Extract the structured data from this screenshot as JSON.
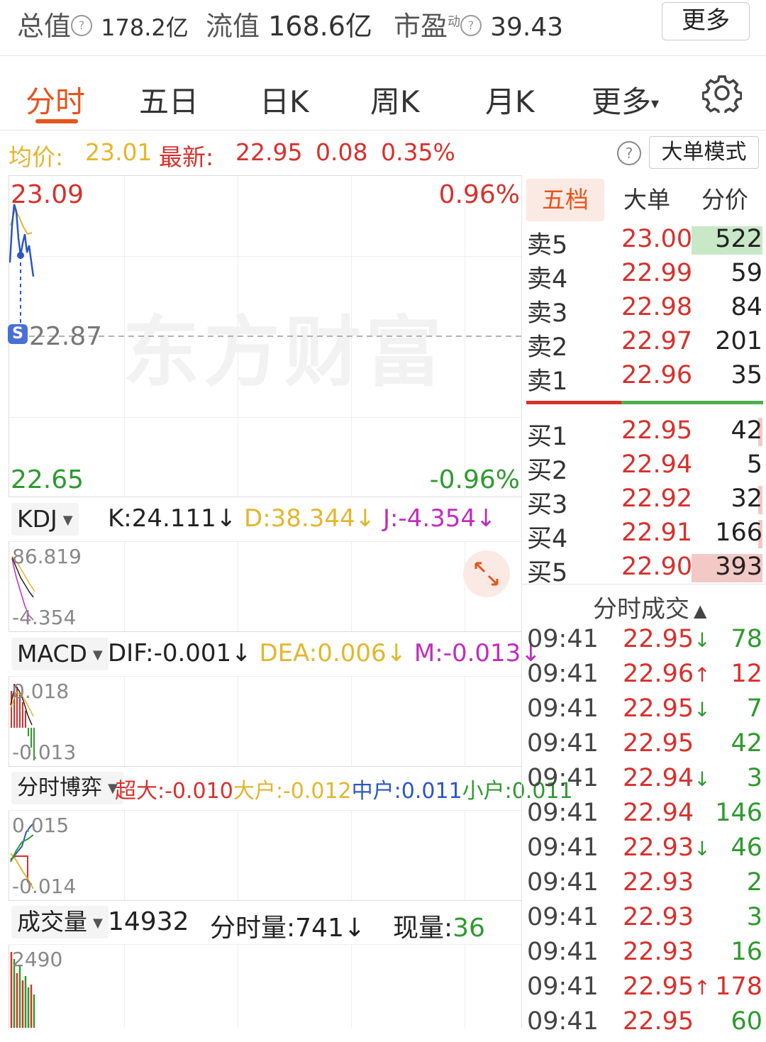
{
  "top": {
    "market_cap_label": "总值",
    "market_cap": "178.2亿",
    "float_label": "流值",
    "float_value": "168.6亿",
    "pe_label": "市盈",
    "pe_super": "动",
    "pe_value": "39.43",
    "more_label": "更多",
    "info_icon": "?"
  },
  "tabs": {
    "items": [
      "分时",
      "五日",
      "日K",
      "周K",
      "月K",
      "更多"
    ],
    "active": "分时",
    "more_caret": "▾"
  },
  "price_row": {
    "avg_label": "均价:",
    "avg": "23.01",
    "latest_label": "最新:",
    "latest": "22.95",
    "change": "0.08",
    "change_pct": "0.35%",
    "help": "?",
    "big_order_label": "大单模式"
  },
  "chart": {
    "high": "23.09",
    "high_pct": "0.96%",
    "mid": "22.87",
    "low": "22.65",
    "low_pct": "-0.96%",
    "watermark": "东方财富",
    "marker_letter": "S"
  },
  "kdj": {
    "name": "KDJ",
    "k": "K:24.111↓",
    "d": "D:38.344↓",
    "j": "J:-4.354↓",
    "max": "86.819",
    "min": "-4.354"
  },
  "macd": {
    "name": "MACD",
    "dif": "DIF:-0.001↓",
    "dea": "DEA:0.006↓",
    "m": "M:-0.013↓",
    "max": "0.018",
    "min": "-0.013"
  },
  "game": {
    "name": "分时博弈",
    "super": "超大:-0.010",
    "big": "大户:-0.012",
    "mid": "中户:0.011",
    "small": "小户:0.011",
    "max": "0.015",
    "min": "-0.014"
  },
  "volume": {
    "name": "成交量",
    "total": "14932",
    "minute_label": "分时量:",
    "minute": "741↓",
    "current_label": "现量:",
    "current": "36",
    "max": "2490"
  },
  "orderbook": {
    "tabs": [
      "五档",
      "大单",
      "分价"
    ],
    "asks": [
      {
        "label": "卖5",
        "price": "23.00",
        "vol": "522",
        "bar": 1.0
      },
      {
        "label": "卖4",
        "price": "22.99",
        "vol": "59",
        "bar": 0
      },
      {
        "label": "卖3",
        "price": "22.98",
        "vol": "84",
        "bar": 0
      },
      {
        "label": "卖2",
        "price": "22.97",
        "vol": "201",
        "bar": 0
      },
      {
        "label": "卖1",
        "price": "22.96",
        "vol": "35",
        "bar": 0
      }
    ],
    "bids": [
      {
        "label": "买1",
        "price": "22.95",
        "vol": "42",
        "bar": 0.05
      },
      {
        "label": "买2",
        "price": "22.94",
        "vol": "5",
        "bar": 0
      },
      {
        "label": "买3",
        "price": "22.92",
        "vol": "32",
        "bar": 0.05
      },
      {
        "label": "买4",
        "price": "22.91",
        "vol": "166",
        "bar": 0.05
      },
      {
        "label": "买5",
        "price": "22.90",
        "vol": "393",
        "bar": 1.0
      }
    ],
    "ticks_title": "分时成交",
    "ticks_caret": "▲",
    "ticks": [
      {
        "time": "09:41",
        "price": "22.95",
        "arrow": "↓",
        "vol": "78"
      },
      {
        "time": "09:41",
        "price": "22.96",
        "arrow": "↑",
        "vol": "12"
      },
      {
        "time": "09:41",
        "price": "22.95",
        "arrow": "↓",
        "vol": "7"
      },
      {
        "time": "09:41",
        "price": "22.95",
        "arrow": "",
        "vol": "42"
      },
      {
        "time": "09:41",
        "price": "22.94",
        "arrow": "↓",
        "vol": "3"
      },
      {
        "time": "09:41",
        "price": "22.94",
        "arrow": "",
        "vol": "146"
      },
      {
        "time": "09:41",
        "price": "22.93",
        "arrow": "↓",
        "vol": "46"
      },
      {
        "time": "09:41",
        "price": "22.93",
        "arrow": "",
        "vol": "2"
      },
      {
        "time": "09:41",
        "price": "22.93",
        "arrow": "",
        "vol": "3"
      },
      {
        "time": "09:41",
        "price": "22.93",
        "arrow": "",
        "vol": "16"
      },
      {
        "time": "09:41",
        "price": "22.95",
        "arrow": "↑",
        "vol": "178"
      },
      {
        "time": "09:41",
        "price": "22.95",
        "arrow": "",
        "vol": "60"
      }
    ]
  },
  "colors": {
    "up": "#d8302c",
    "down": "#2e9a2e",
    "accent": "#e5541a",
    "avg": "#e4b62c"
  }
}
